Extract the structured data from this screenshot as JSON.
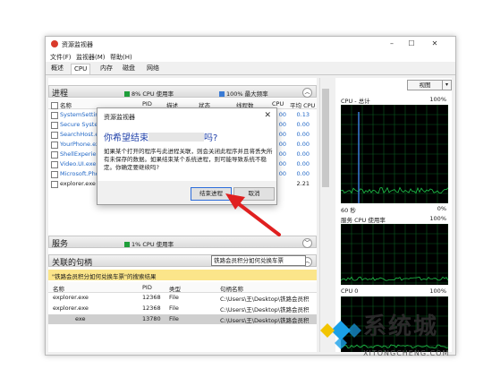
{
  "window": {
    "title": "资源监视器",
    "controls": [
      "–",
      "☐",
      "✕"
    ]
  },
  "menu": [
    "文件(F)",
    "监视器(M)",
    "帮助(H)"
  ],
  "tabs": [
    {
      "label": "概述",
      "active": false
    },
    {
      "label": "CPU",
      "active": true
    },
    {
      "label": "内存",
      "active": false
    },
    {
      "label": "磁盘",
      "active": false
    },
    {
      "label": "网络",
      "active": false
    }
  ],
  "processes": {
    "title": "进程",
    "cpu_usage": "8% CPU 使用率",
    "max_freq": "100% 最大频率",
    "columns": [
      "名称",
      "PID",
      "描述",
      "状态",
      "线程数",
      "CPU",
      "平均 CPU"
    ],
    "rows": [
      {
        "name": "SystemSettings",
        "cpu": "00",
        "avg": "0.13"
      },
      {
        "name": "Secure System",
        "cpu": "00",
        "avg": "0.00"
      },
      {
        "name": "SearchHost.exe",
        "cpu": "00",
        "avg": "0.00"
      },
      {
        "name": "YourPhone.exe",
        "cpu": "00",
        "avg": "0.00"
      },
      {
        "name": "ShellExperience",
        "cpu": "00",
        "avg": "0.00"
      },
      {
        "name": "Video.UI.exe",
        "cpu": "00",
        "avg": "0.00"
      },
      {
        "name": "Microsoft.Pho",
        "cpu": "00",
        "avg": "0.00"
      },
      {
        "name": "explorer.exe",
        "cpu": "",
        "avg": "2.21"
      }
    ]
  },
  "services": {
    "title": "服务",
    "cpu_usage": "1% CPU 使用率"
  },
  "handles": {
    "title": "关联的句柄",
    "search_value": "铁路会员积分如何兑换车票",
    "banner": "\"铁路会员积分如何兑换车票\"的搜索结果",
    "columns": [
      "名称",
      "PID",
      "类型",
      "句柄名称"
    ],
    "rows": [
      {
        "name": "explorer.exe",
        "pid": "12368",
        "type": "File",
        "handle": "C:\\Users\\王\\Desktop\\铁路会员积",
        "selected": false
      },
      {
        "name": "explorer.exe",
        "pid": "12368",
        "type": "File",
        "handle": "C:\\Users\\王\\Desktop\\铁路会员积",
        "selected": false
      },
      {
        "name": "exe",
        "pid": "13780",
        "type": "File",
        "handle": "C:\\Users\\王\\Desktop\\铁路会员积",
        "selected": true
      }
    ]
  },
  "right": {
    "view_label": "视图",
    "graphs": [
      {
        "label": "CPU - 总计",
        "max": "100%",
        "bottom_left": "60 秒",
        "bottom_right": "0%"
      },
      {
        "label": "服务 CPU 使用率",
        "max": "100%",
        "bottom_left": "",
        "bottom_right": ""
      },
      {
        "label": "CPU 0",
        "max": "100%",
        "bottom_left": "",
        "bottom_right": ""
      }
    ]
  },
  "dialog": {
    "title": "资源监视器",
    "heading_prefix": "你希望结束",
    "heading_suffix": "吗?",
    "message": "如果某个打开的程序与此进程关联，则会关闭此程序并且将丢失所有未保存的数据。如果结束某个系统进程，则可能导致系统不稳定。你确定要继续吗?",
    "confirm_button": "结束进程",
    "cancel_button": "取消"
  },
  "watermark": {
    "text": "系统城",
    "url": "XITONGCHENG.COM"
  },
  "colors": {
    "accent": "#2268c7",
    "graph_line": "#1fc24a",
    "arrow": "#e02020",
    "banner": "#fbe58a"
  }
}
